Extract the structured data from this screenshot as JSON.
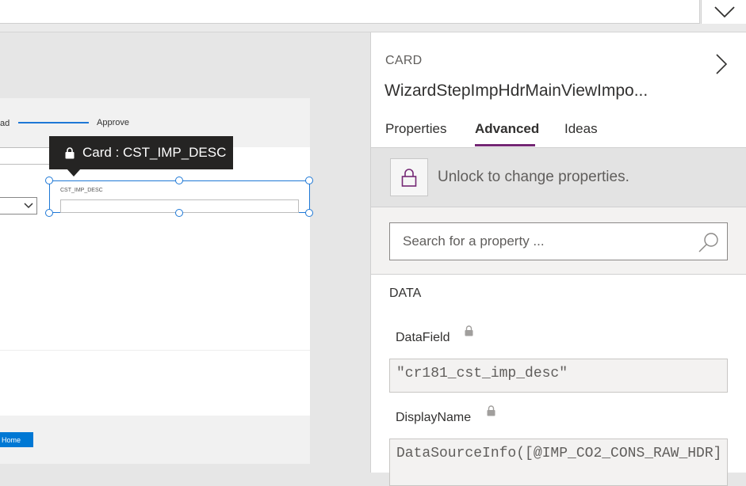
{
  "formula_bar": {
    "value": "",
    "expand_icon": "chevron-down-icon"
  },
  "canvas": {
    "stepper": {
      "prev_step_fragment": "ad",
      "next_step": "Approve"
    },
    "tooltip": {
      "icon": "lock-icon",
      "text": "Card : CST_IMP_DESC"
    },
    "selected_card": {
      "field_label": "CST_IMP_DESC",
      "value": ""
    },
    "home_button": "Home",
    "accent_color": "#1e78d6"
  },
  "panel": {
    "kind": "CARD",
    "title": "WizardStepImpHdrMainViewImpo...",
    "expand_icon": "chevron-right-icon",
    "tabs": [
      {
        "label": "Properties",
        "active": false
      },
      {
        "label": "Advanced",
        "active": true
      },
      {
        "label": "Ideas",
        "active": false
      }
    ],
    "active_tab_color": "#742774",
    "unlock": {
      "icon": "lock-icon",
      "text": "Unlock to change properties."
    },
    "search": {
      "placeholder": "Search for a property ...",
      "icon": "search-icon"
    },
    "sections": [
      {
        "heading": "DATA",
        "properties": [
          {
            "name": "DataField",
            "locked": true,
            "value": "\"cr181_cst_imp_desc\""
          },
          {
            "name": "DisplayName",
            "locked": true,
            "value": "DataSourceInfo([@IMP_CO2_CONS_RAW_HDR]"
          }
        ]
      }
    ]
  }
}
